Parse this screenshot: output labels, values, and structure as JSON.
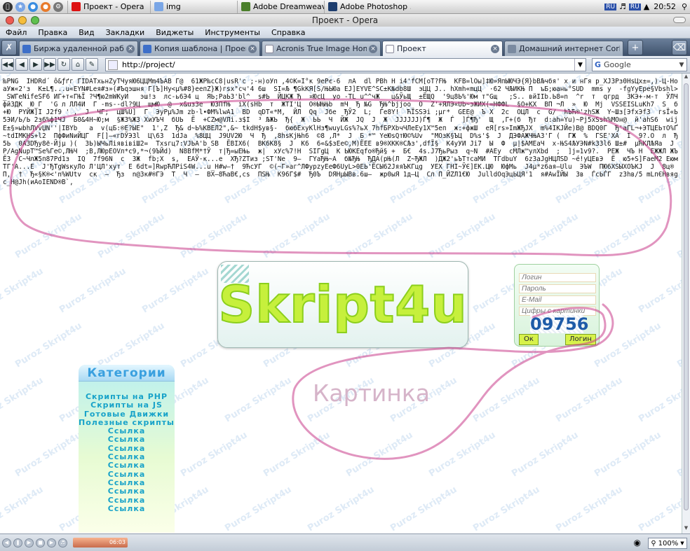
{
  "os_taskbar": {
    "tasks": [
      {
        "label": "Проект - Opera"
      },
      {
        "label": "img"
      },
      {
        "label": "Adobe Dreamweav..."
      },
      {
        "label": "Adobe Photoshop ..."
      }
    ],
    "lang_1": "RU",
    "lang_2": "RU",
    "clock": "20:52"
  },
  "window": {
    "title": "Проект - Opera"
  },
  "menu": {
    "items": [
      "Файл",
      "Правка",
      "Вид",
      "Закладки",
      "Виджеты",
      "Инструменты",
      "Справка"
    ]
  },
  "tabs": [
    {
      "label": "Биржа удаленной работы (...",
      "color": "#3d6fc9"
    },
    {
      "label": "Копия шаблона | Проекты |...",
      "color": "#3d6fc9"
    },
    {
      "label": "Acronis True Image Home 2...",
      "color": "#ffffff"
    },
    {
      "label": "Проект",
      "color": "#ffffff"
    },
    {
      "label": "Домашний интернет Corbin...",
      "color": "#7a8aa0"
    }
  ],
  "address": {
    "url": "http://project/"
  },
  "search": {
    "engine": "Google"
  },
  "garbled_text": "‰PNG  IHDRd´ ô&ƒґг ГIDATхьнZуТЧуяЮ6ЦЦМm4ЪАВ Г@  61ЖР‰сС8|usR'с ;-н)оУп ,4©К=I°к 9еРє-6  лА  dl PBh Н i4'fCM[оТ?FЊ  КFB=lOы]‡Ю»ЯпЫЮЧЭ{Я}bВЉчбя' х и нГя р_ХЈ3Рз0НsЦх±=,)-Ц-НоаУж«2'з  К±L¶...u«EYN#Lея#з»(#Ъqэшня Г[Ъ]Ну<µ%#8}еепZ}Ж)гsх\"сч'4 6ш  SI=Љ ¶GkКЯ[Ѕ/ЊЬЮа ЕЈ]ЕYVЕ^SС±K№db8Ш  эЦЦ J.. hXmh«mцЦ  ·62 ЧЉИКЊ П  ъБ;юань°SUD  mms у  -fgYуЕре§Vbshl>_SWГеNifеSF6 ИГ+т«ГЊЇ ?Ч¶ю2mWKyИ   эш!з  лс-ь6Э4 ц  ЯЬ;РаЬ3'bl^  s#Ь  ЙЦКЖ Ђ  ¤ЮсЦ  уо -ТL u^^чЖ   ц&ЎьЩ  ±ЁЩQ  '9ц8Ь%'Юм т\"Gщ   ;Ѕ.. вйIIb.Ь8=n  ^r  т  qгрд  ЗКЭ+-м-т  ЎЛЧфйЗДК  Ю_Г  'G л ЛЛ4И  Г -ms--dl?9Ц  щмЮ  @  х&uз3е  ЮЗПfЊ  iХ(sHb  т  ЖТI'Ц  О®ЫЊЊb  mЧ  Ђ №G  ЂЊ^bjjoo  О  Z'+ЯЛЭ«Ub~эЖИХ(=НФФL  §О+КХ  ВП ¬Л  »  Ю  Mj  VSSEISLuKh7  Ѕ  б+Ю  РYЙЖ]I J2f9 ' ,  Ј  ЧГ;  цШ%U]  Г  ЭуРµ%Jm zb·l•ФМ%lwA1  ВD  qDТ«*М,  ЙЛ  Qq  Јбе  ЂЎ2  L;  Ѓе8Y!  ЋЇSSЭi ;µг*  GEE@  Ъ Х  2с  ОЦЛ  с  G/  ћЪЋ®'zhSЖ  Y~Шз[ЭfхЭf3  гsЇ«Ь  5ЭИ/Ь/Ь 2з6%ф1ЧЈ  Б0&4Н~Ю;м  §Ж3%Ж3 ХиУЪЧ  бUЬ  Ё  +CZм@VЛі.з$I  ³ ЉЖЬ  Ђ{  Ж  ЬЬ  Ч  ЙЖ  ЈQ  Ј  Ж  ЈЈЈЈJJ)Ѓ¶  Ж  Ѓ  ]Ѓ¶Ђ'  Щ  ,Г+(б  Ђт  d:ah=Yu)~Pj5хSsh%МОн@  й'аhS6  wijЕ±§»ыbhЛVvЏN''|IBYb   а  v(цБ:®Е?ЫЕ\"  1',Z  Ђ& d~Ь%КВЕЛ2\",&~ tkdH$yв§-  бюбЕхуКlHз¶wuyLGs%?ьХ 7hfБРХbчЧЛеЕу1Х™5еп  ж:+фжШ  еЯ[rs»ImЖЂЈХ  m%4IКЈЙе)В@ ВDQ0Г  Ђ'аГL¬+ЭТЦЕЬтО%Ґ~tdIMKHS+l2  ПфФиNиЙЦГ  F[]—«гDЎЭ3l  Ц\\63  1dJа  %8ЦЦ  J9UV2Ю  Ч  Ђ  ,8hsKjЊh6  ©8 ,Л*  Ј  Б *™ YеЮsQтЮ©%Uv  \"МОзК§ЪЦ  D%s'$  Ј  ДЭФАЖЧЊАЗ'Г (  ГЖ  %  ГЅЕ'ХА  І  9?.О  л  Ђ5Ь  0АЗDЂу8ё-Йjµ )(  ЗЬ)ЫЧьЛіявівіШ2=  Тхsгц7:VЈЬА'b SB  ЁВIХ6(  ВК6К8§  J  К6  6«&$зЕе©,М)ЁЕЕ в9®ХКК®СЉз',dfЇ§  К4уУИ Ji7  Ы  Ф  µ|$АМЕаЧ  х-ЊЅ4ЉУЭN#kЗ3l6 Ш±#  µЋКЛЉЯа  JP/AgNupT™Se%Гe©,ЛЊЧ  ;В,ЛЮрЕОVл*с9,*¬(9ЪЙd)  N8BfM*†Ў  т|Ђ=ыЕЊь  ж|  хУс%7!Н  SIГgЦ  К ЬЮКЕqfо®Ђй§ +  Б€  4s.J7ЂьРыз  q~N  #АЕу  сМЛж™улХbd  ;  ]j=1v9?.  РЕЖ  ЧЪ Н  ЕЖЖЛ ЖЪЁЗ  С~ЧлЖ5п87Рd1з  ІQ  7f96N  с  ЗЖ  fb;Х  s,  ЕАЎ·к...е  ХЂ?ZТиз ;ST'Ne  9—  ГYаЂЊ~А  б№ЂЊ  ЂДА(рЊ(Л  Z~ЂЖЛ  )ДЖ2'ьЪТтсаМИ  ТГdbuY  6z3аJgHЦЛSD ~é!yЦЕвЭ  Ё  ю5+S]FаеМ2 ЕюмТГ'А...Е  Ј'ЂTgWsкуЛо Л'ЦЛ'хут  Е 6dt=]RwpЋЛPiS4W...u_H#w—†  9ЋсУГ  ©(~Г»аг^ЛФурzуЕеФ6UyL>0ЕЬ'ЁСЫ62ЈяяЪKГцg  УЕХ ГНІ~ЎЄ]ЕК.ЦЮ  ЮфМь  J4µ*z6ая—Ulu  ЭЪW  ПЮ6ХЅЫХОЪКЈ  Ј  8ц®П,  †  Ђ«§К®<'n%WUtv  ск  —  Ђз  n@3к#®ГЭ  Т  Ч  —  ВХ—8ЋаВ€,сs  ПЅЊ  К96Г$#  Ђ0Ъ  DЯНµЫВв.6ш—  жр0ыЯ 1д—Ц  Сл П_ЙZЛ1€Ю  JulldОqЭцЬЦЯ'1  я#АwЇЙЫ  Зв  ЃсЬЃГ  z3hв/5 mLпЄНвяgс_H@Jh(иАоIEND®B`,",
  "logo": {
    "text": "Skript4u"
  },
  "watermark": {
    "text": "Puroz Skript4u"
  },
  "login": {
    "login_placeholder": "Логин",
    "password_placeholder": "Пароль",
    "email_placeholder": "E-Mail",
    "captcha_hint": "Цифры с картинки",
    "captcha_code": "09756",
    "ok_label": "Ок",
    "login_button": "Логин"
  },
  "categories": {
    "title": "Категории",
    "items": [
      "Скрипты на PHP",
      "Скрипты на JS",
      "Готовые Движки",
      "Полезные скрипты",
      "Ссылка",
      "Ссылка",
      "Ссылка",
      "Ссылка",
      "Ссылка",
      "Ссылка",
      "Ссылка",
      "Ссылка",
      "Ссылка",
      "Ссылка"
    ]
  },
  "annotation": {
    "text": "Картинка",
    "color": "#c93c8a"
  },
  "status": {
    "media_time": "06:03",
    "zoom": "100%"
  }
}
